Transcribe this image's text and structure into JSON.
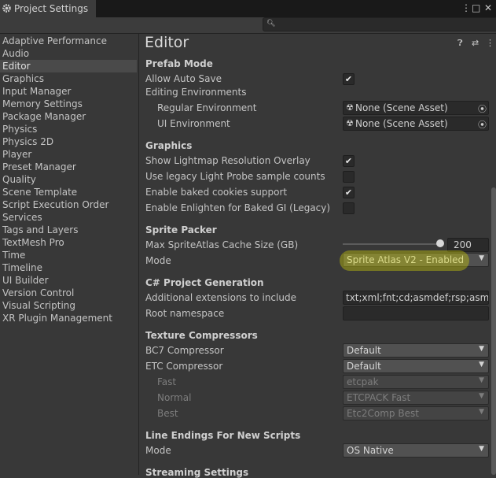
{
  "window": {
    "tab_title": "Project Settings",
    "menu_icon": "kebab-menu-icon",
    "maximize_icon": "maximize-icon",
    "close_icon": "close-icon"
  },
  "search": {
    "placeholder": "",
    "icon": "search-icon"
  },
  "sidebar": {
    "items": [
      {
        "label": "Adaptive Performance"
      },
      {
        "label": "Audio"
      },
      {
        "label": "Editor",
        "selected": true
      },
      {
        "label": "Graphics"
      },
      {
        "label": "Input Manager"
      },
      {
        "label": "Memory Settings"
      },
      {
        "label": "Package Manager"
      },
      {
        "label": "Physics"
      },
      {
        "label": "Physics 2D"
      },
      {
        "label": "Player"
      },
      {
        "label": "Preset Manager"
      },
      {
        "label": "Quality"
      },
      {
        "label": "Scene Template"
      },
      {
        "label": "Script Execution Order"
      },
      {
        "label": "Services"
      },
      {
        "label": "Tags and Layers"
      },
      {
        "label": "TextMesh Pro"
      },
      {
        "label": "Time"
      },
      {
        "label": "Timeline"
      },
      {
        "label": "UI Builder"
      },
      {
        "label": "Version Control"
      },
      {
        "label": "Visual Scripting"
      },
      {
        "label": "XR Plugin Management"
      }
    ]
  },
  "main": {
    "title": "Editor",
    "prefab": {
      "header": "Prefab Mode",
      "allow_auto_save": {
        "label": "Allow Auto Save",
        "checked": true
      },
      "editing_env": "Editing Environments",
      "regular_env": {
        "label": "Regular Environment",
        "value": "None (Scene Asset)"
      },
      "ui_env": {
        "label": "UI Environment",
        "value": "None (Scene Asset)"
      }
    },
    "graphics": {
      "header": "Graphics",
      "lightmap_overlay": {
        "label": "Show Lightmap Resolution Overlay",
        "checked": true
      },
      "legacy_probe": {
        "label": "Use legacy Light Probe sample counts",
        "checked": false
      },
      "baked_cookies": {
        "label": "Enable baked cookies support",
        "checked": true
      },
      "enlighten": {
        "label": "Enable Enlighten for Baked GI (Legacy)",
        "checked": false
      }
    },
    "sprite": {
      "header": "Sprite Packer",
      "cache_size": {
        "label": "Max SpriteAtlas Cache Size (GB)",
        "value": "200",
        "fraction": 1.0
      },
      "mode": {
        "label": "Mode",
        "value": "Sprite Atlas V2 - Enabled"
      }
    },
    "csharp": {
      "header": "C# Project Generation",
      "extensions": {
        "label": "Additional extensions to include",
        "value": "txt;xml;fnt;cd;asmdef;rsp;asmref"
      },
      "root_ns": {
        "label": "Root namespace",
        "value": ""
      }
    },
    "texture": {
      "header": "Texture Compressors",
      "bc7": {
        "label": "BC7 Compressor",
        "value": "Default"
      },
      "etc": {
        "label": "ETC Compressor",
        "value": "Default"
      },
      "fast": {
        "label": "Fast",
        "value": "etcpak"
      },
      "normal": {
        "label": "Normal",
        "value": "ETCPACK Fast"
      },
      "best": {
        "label": "Best",
        "value": "Etc2Comp Best"
      }
    },
    "line_endings": {
      "header": "Line Endings For New Scripts",
      "mode": {
        "label": "Mode",
        "value": "OS Native"
      }
    },
    "streaming": {
      "header": "Streaming Settings"
    }
  }
}
